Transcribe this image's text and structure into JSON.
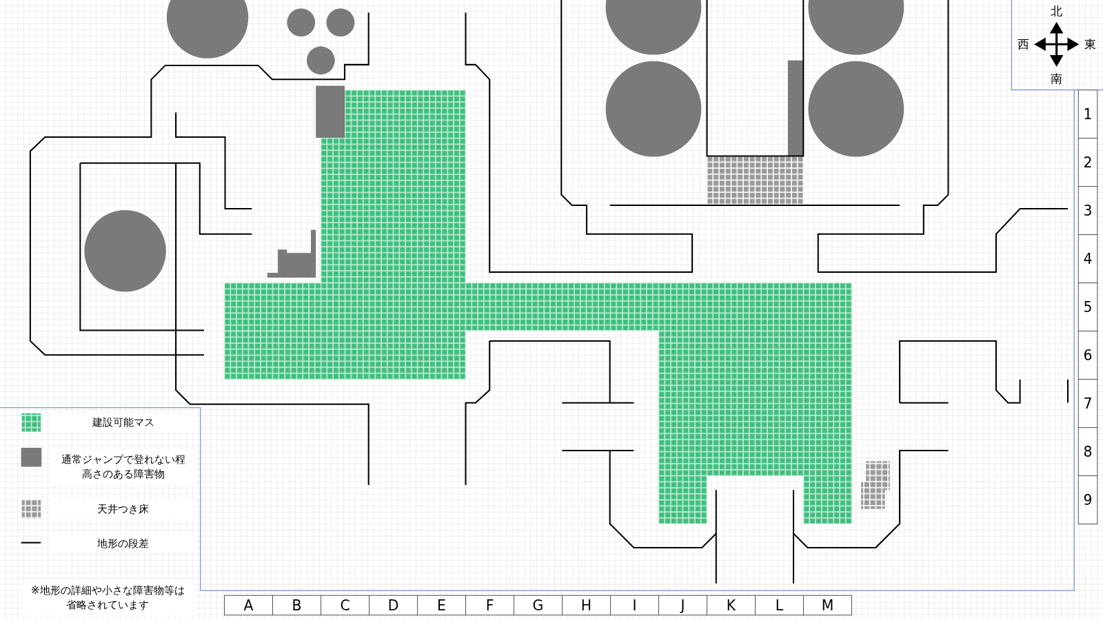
{
  "compass": {
    "north": "北",
    "west": "西",
    "east": "東",
    "south": "南"
  },
  "columns": [
    "A",
    "B",
    "C",
    "D",
    "E",
    "F",
    "G",
    "H",
    "I",
    "J",
    "K",
    "L",
    "M"
  ],
  "rows": [
    "1",
    "2",
    "3",
    "4",
    "5",
    "6",
    "7",
    "8",
    "9"
  ],
  "legend": [
    {
      "kind": "buildable",
      "label": "建設可能マス"
    },
    {
      "kind": "obstacle",
      "label": [
        "通常ジャンプで登れない程",
        "高さのある障害物"
      ]
    },
    {
      "kind": "ceiling",
      "label": "天井つき床"
    },
    {
      "kind": "step",
      "label": "地形の段差"
    }
  ],
  "note": [
    "※地形の詳細や小さな障害物等は",
    "省略されています"
  ]
}
